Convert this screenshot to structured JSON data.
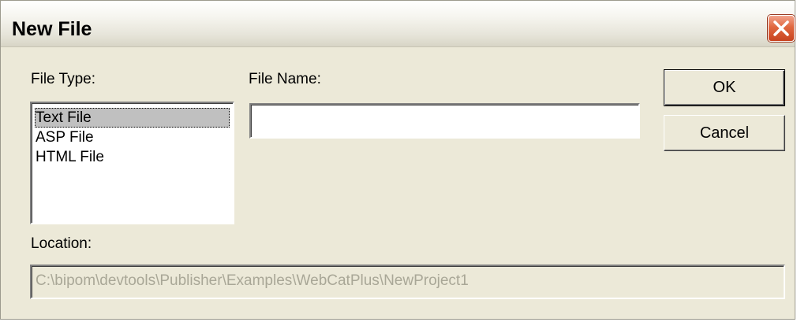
{
  "window": {
    "title": "New File",
    "close_icon": "close-x-icon"
  },
  "file_type": {
    "label": "File Type:",
    "items": [
      {
        "label": "Text File",
        "selected": true
      },
      {
        "label": "ASP File",
        "selected": false
      },
      {
        "label": "HTML File",
        "selected": false
      }
    ]
  },
  "file_name": {
    "label": "File Name:",
    "value": ""
  },
  "buttons": {
    "ok_label": "OK",
    "cancel_label": "Cancel"
  },
  "location": {
    "label": "Location:",
    "value": "C:\\bipom\\devtools\\Publisher\\Examples\\WebCatPlus\\NewProject1"
  },
  "colors": {
    "dialog_bg": "#ece9d8",
    "close_button": "#e0673f",
    "selection": "#c0c0c0",
    "disabled_text": "#a9a797"
  }
}
